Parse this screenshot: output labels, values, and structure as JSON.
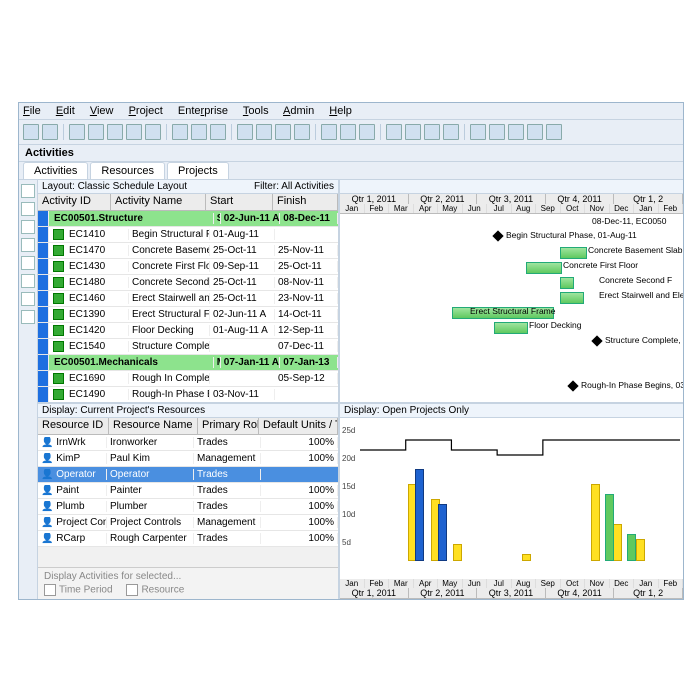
{
  "menu": [
    "File",
    "Edit",
    "View",
    "Project",
    "Enterprise",
    "Tools",
    "Admin",
    "Help"
  ],
  "section_title": "Activities",
  "tabs": [
    "Activities",
    "Resources",
    "Projects"
  ],
  "layout_label": "Layout: Classic Schedule Layout",
  "filter_label": "Filter: All Activities",
  "act_cols": {
    "id": "Activity ID",
    "name": "Activity Name",
    "start": "Start",
    "finish": "Finish"
  },
  "acts": [
    {
      "g": true,
      "id": "EC00501.Structure",
      "name": "Structure",
      "start": "02-Jun-11 A",
      "finish": "08-Dec-11"
    },
    {
      "id": "EC1410",
      "name": "Begin Structural Phase",
      "start": "01-Aug-11",
      "finish": ""
    },
    {
      "id": "EC1470",
      "name": "Concrete Basement Slab",
      "start": "25-Oct-11",
      "finish": "25-Nov-11"
    },
    {
      "id": "EC1430",
      "name": "Concrete First Floor",
      "start": "09-Sep-11",
      "finish": "25-Oct-11"
    },
    {
      "id": "EC1480",
      "name": "Concrete Second Floor",
      "start": "25-Oct-11",
      "finish": "08-Nov-11"
    },
    {
      "id": "EC1460",
      "name": "Erect Stairwell and Elevator Walls",
      "start": "25-Oct-11",
      "finish": "23-Nov-11"
    },
    {
      "id": "EC1390",
      "name": "Erect Structural Frame",
      "start": "02-Jun-11 A",
      "finish": "14-Oct-11"
    },
    {
      "id": "EC1420",
      "name": "Floor Decking",
      "start": "01-Aug-11 A",
      "finish": "12-Sep-11"
    },
    {
      "id": "EC1540",
      "name": "Structure Complete",
      "start": "",
      "finish": "07-Dec-11"
    },
    {
      "g": true,
      "id": "EC00501.Mechanicals",
      "name": "Mechanical/E",
      "start": "07-Jan-11 A",
      "finish": "07-Jan-13"
    },
    {
      "id": "EC1690",
      "name": "Rough In Complete",
      "start": "",
      "finish": "05-Sep-12"
    },
    {
      "id": "EC1490",
      "name": "Rough-In Phase Begins",
      "start": "03-Nov-11",
      "finish": ""
    }
  ],
  "quarters": [
    "Qtr 1, 2011",
    "Qtr 2, 2011",
    "Qtr 3, 2011",
    "Qtr 4, 2011",
    "Qtr 1, 2"
  ],
  "months": [
    "Jan",
    "Feb",
    "Mar",
    "Apr",
    "May",
    "Jun",
    "Jul",
    "Aug",
    "Sep",
    "Oct",
    "Nov",
    "Dec",
    "Jan",
    "Feb"
  ],
  "gantt_labels": {
    "t08": "08-Dec-11, EC0050",
    "t1": "Begin Structural Phase, 01-Aug-11",
    "t2": "Concrete Basement Slab",
    "t3": "Concrete First Floor",
    "t4": "Concrete Second F",
    "t5": "Erect Stairwell and Elev",
    "t6": "Erect Structural Frame",
    "t7": "Floor Decking",
    "t8": "Structure Complete,",
    "t9": "Rough-In Phase Begins, 03"
  },
  "res_lay": "Display: Current Project's Resources",
  "res_cols": {
    "id": "Resource ID",
    "name": "Resource Name",
    "role": "Primary Role",
    "def": "Default Units / Time"
  },
  "res": [
    {
      "id": "IrnWrk",
      "name": "Ironworker",
      "role": "Trades",
      "def": "100%"
    },
    {
      "id": "KimP",
      "name": "Paul Kim",
      "role": "Management",
      "def": "100%"
    },
    {
      "id": "Operator",
      "name": "Operator",
      "role": "Trades",
      "def": "",
      "sel": true
    },
    {
      "id": "Paint",
      "name": "Painter",
      "role": "Trades",
      "def": "100%"
    },
    {
      "id": "Plumb",
      "name": "Plumber",
      "role": "Trades",
      "def": "100%"
    },
    {
      "id": "Project Cont",
      "name": "Project Controls",
      "role": "Management",
      "def": "100%"
    },
    {
      "id": "RCarp",
      "name": "Rough Carpenter",
      "role": "Trades",
      "def": "100%"
    }
  ],
  "chart_lay": "Display: Open Projects Only",
  "yaxis": [
    "25d",
    "20d",
    "15d",
    "10d",
    "5d"
  ],
  "filter_placeholder": "Display Activities for selected...",
  "chk1": "Time Period",
  "chk2": "Resource",
  "chart_data": {
    "type": "bar",
    "categories": [
      "Jan",
      "Feb",
      "Mar",
      "Apr",
      "May",
      "Jun",
      "Jul",
      "Aug",
      "Sep",
      "Oct",
      "Nov",
      "Dec",
      "Jan",
      "Feb"
    ],
    "series": [
      {
        "name": "yellow",
        "color": "#ffe022",
        "values": [
          0,
          0,
          15,
          12,
          3,
          0,
          0,
          1,
          0,
          0,
          15,
          7,
          4,
          0
        ]
      },
      {
        "name": "blue",
        "color": "#1e62d0",
        "values": [
          0,
          0,
          18,
          11,
          0,
          0,
          0,
          0,
          0,
          0,
          0,
          0,
          0,
          0
        ]
      },
      {
        "name": "green",
        "color": "#5fc95f",
        "values": [
          0,
          0,
          0,
          0,
          0,
          0,
          0,
          0,
          0,
          0,
          13,
          5,
          0,
          0
        ]
      }
    ],
    "ylim": [
      0,
      25
    ],
    "y_ticks": [
      5,
      10,
      15,
      20,
      25
    ],
    "step_line": [
      20,
      20,
      22,
      22,
      20,
      20,
      19,
      19,
      22,
      22,
      22,
      22,
      22,
      22
    ]
  }
}
